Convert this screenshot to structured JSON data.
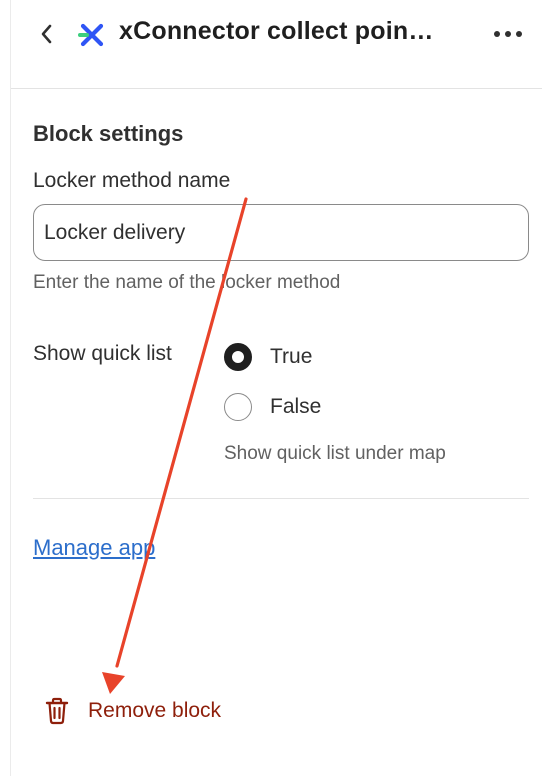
{
  "header": {
    "title": "xConnector collect poin…",
    "back_icon": "chevron-left-icon",
    "more_icon": "more-horizontal-icon",
    "logo_icon": "xconnector-logo-icon"
  },
  "block_settings": {
    "title": "Block settings",
    "locker_method": {
      "label": "Locker method name",
      "value": "Locker delivery",
      "help": "Enter the name of the locker method"
    },
    "quick_list": {
      "label": "Show quick list",
      "options": [
        {
          "label": "True",
          "checked": true
        },
        {
          "label": "False",
          "checked": false
        }
      ],
      "help": "Show quick list under map"
    }
  },
  "manage_link": "Manage app",
  "remove": {
    "label": "Remove block",
    "icon": "trash-icon"
  },
  "colors": {
    "link": "#2c6ecb",
    "critical": "#8e1f0b",
    "annotation_arrow": "#e8432a",
    "logo_blue": "#2f55f5",
    "logo_green": "#3ccf7e"
  }
}
